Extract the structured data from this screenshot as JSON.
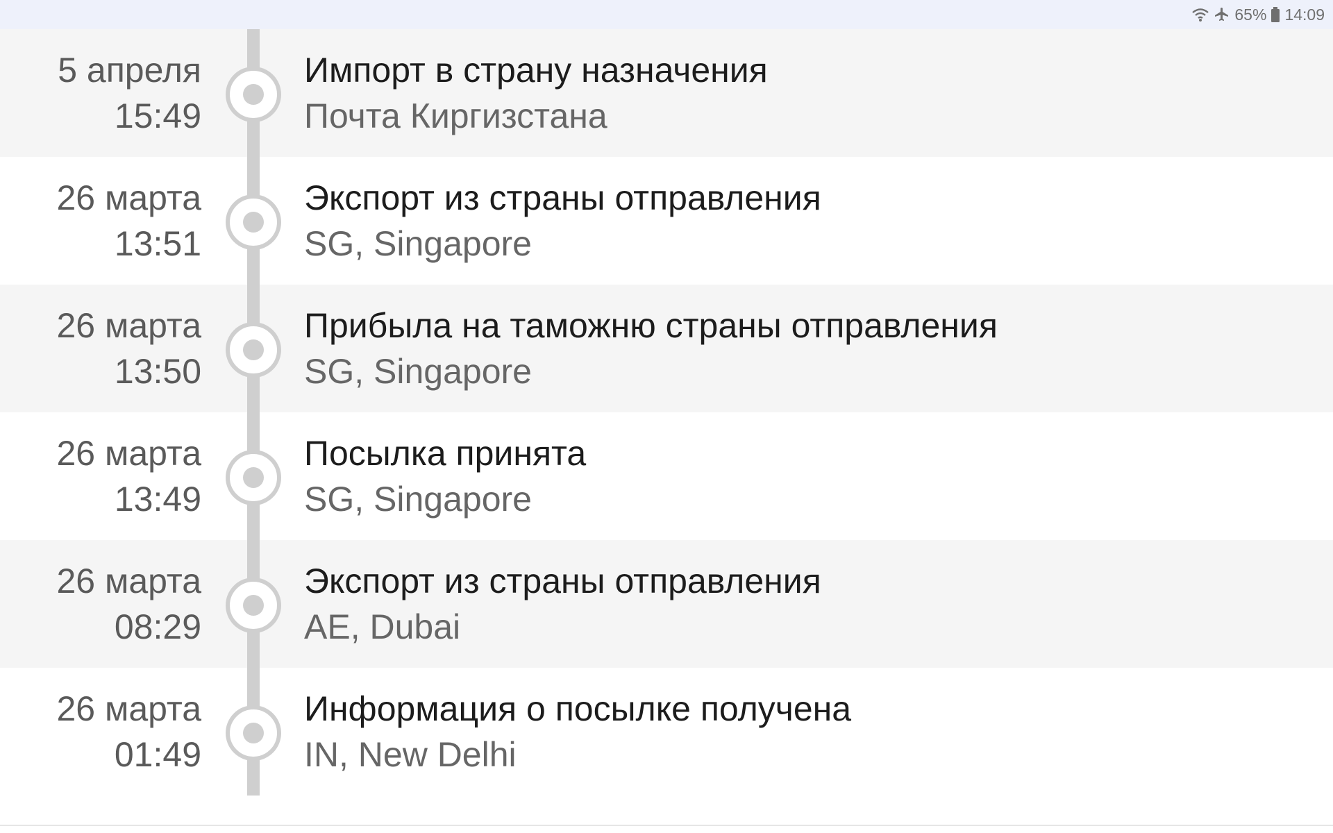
{
  "status_bar": {
    "icons": [
      "wifi-icon",
      "airplane-mode-icon",
      "battery-icon"
    ],
    "battery": "65%",
    "time": "14:09"
  },
  "events": [
    {
      "date": "5 апреля",
      "time": "15:49",
      "title": "Импорт в страну назначения",
      "place": "Почта Киргизстана"
    },
    {
      "date": "26 марта",
      "time": "13:51",
      "title": "Экспорт из страны отправления",
      "place": "SG, Singapore"
    },
    {
      "date": "26 марта",
      "time": "13:50",
      "title": "Прибыла на таможню страны отправления",
      "place": "SG, Singapore"
    },
    {
      "date": "26 марта",
      "time": "13:49",
      "title": "Посылка принята",
      "place": "SG, Singapore"
    },
    {
      "date": "26 марта",
      "time": "08:29",
      "title": "Экспорт из страны отправления",
      "place": "AE, Dubai"
    },
    {
      "date": "26 марта",
      "time": "01:49",
      "title": "Информация о посылке получена",
      "place": "IN, New Delhi"
    }
  ],
  "colors": {
    "statusbar_bg": "#eef1fb",
    "row_shade": "#f5f5f5",
    "timeline": "#cfcfcf",
    "title_text": "#1c1c1c",
    "secondary_text": "#666666"
  }
}
